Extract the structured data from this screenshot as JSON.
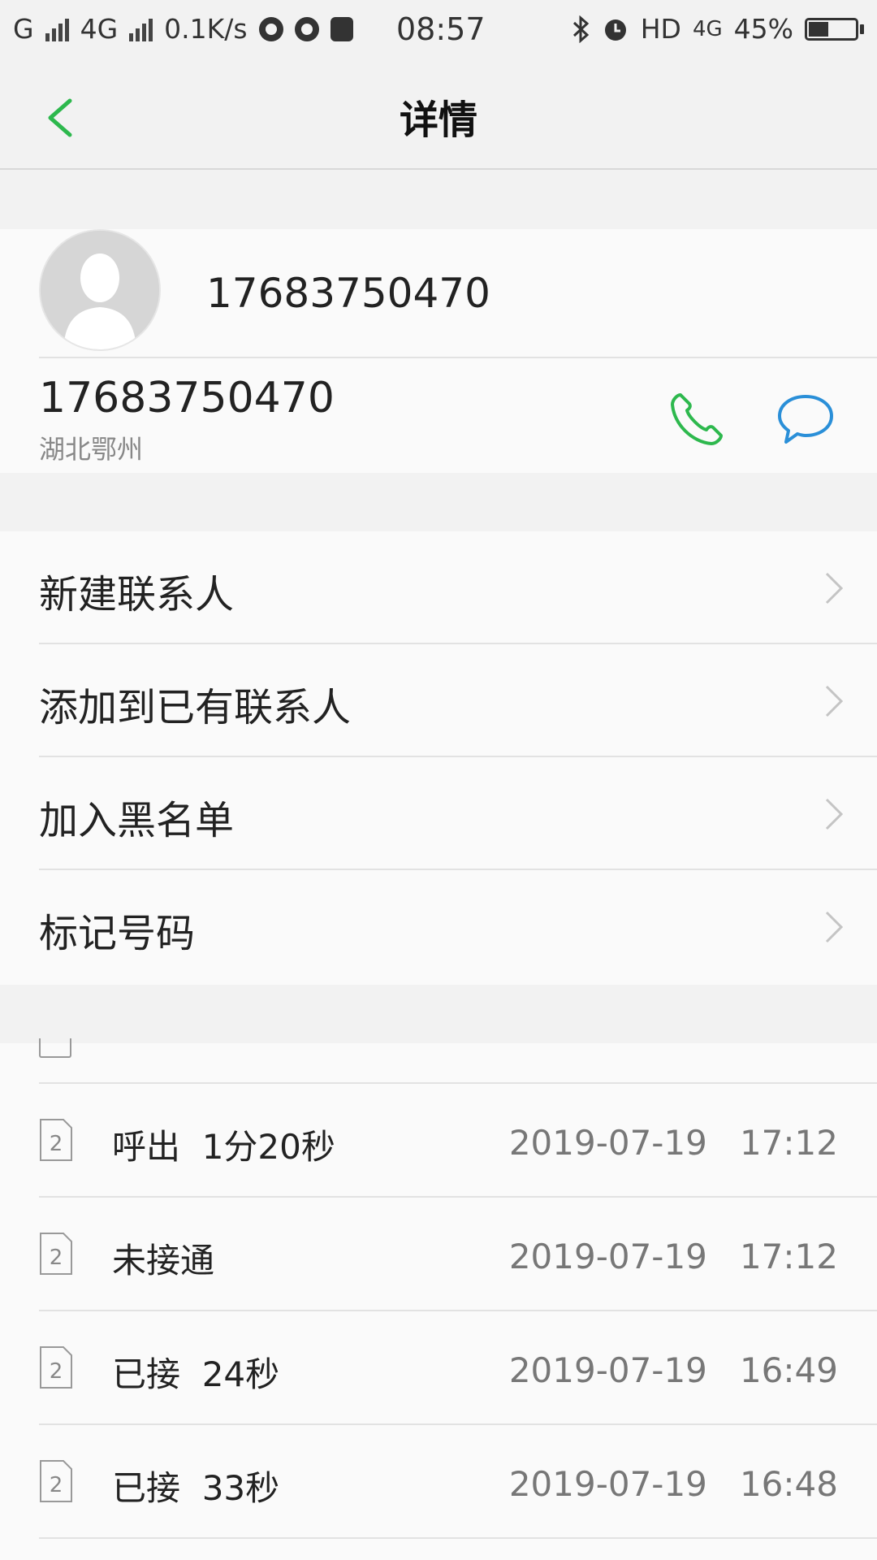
{
  "status_bar": {
    "carrier1": "G",
    "carrier2": "4G",
    "speed": "0.1K/s",
    "time": "08:57",
    "hd": "HD",
    "net": "4G",
    "battery": "45%"
  },
  "nav": {
    "title": "详情"
  },
  "contact": {
    "display_name": "17683750470",
    "number": "17683750470",
    "location": "湖北鄂州"
  },
  "menu": [
    {
      "label": "新建联系人"
    },
    {
      "label": "添加到已有联系人"
    },
    {
      "label": "加入黑名单"
    },
    {
      "label": "标记号码"
    }
  ],
  "call_log": [
    {
      "sim": "2",
      "desc": "呼出  1分20秒",
      "datetime": "2019-07-19   17:12"
    },
    {
      "sim": "2",
      "desc": "未接通",
      "datetime": "2019-07-19   17:12"
    },
    {
      "sim": "2",
      "desc": "已接  24秒",
      "datetime": "2019-07-19   16:49"
    },
    {
      "sim": "2",
      "desc": "已接  33秒",
      "datetime": "2019-07-19   16:48"
    }
  ],
  "colors": {
    "accent_green": "#2db84d",
    "accent_blue": "#2a8fd8"
  }
}
